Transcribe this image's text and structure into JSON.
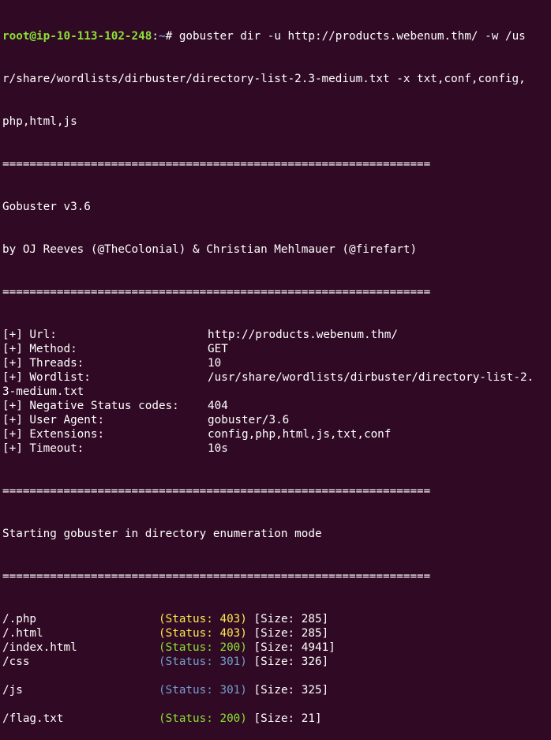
{
  "prompt": {
    "user_host": "root@ip-10-113-102-248",
    "colon": ":",
    "path": "~",
    "symbol": "# ",
    "command_line1": "gobuster dir -u http://products.webenum.thm/ -w /us",
    "command_line2": "r/share/wordlists/dirbuster/directory-list-2.3-medium.txt -x txt,conf,config,",
    "command_line3": "php,html,js"
  },
  "separator": "===============================================================",
  "banner": {
    "title": "Gobuster v3.6",
    "authors": "by OJ Reeves (@TheColonial) & Christian Mehlmauer (@firefart)"
  },
  "config": [
    {
      "key": "[+] Url:",
      "value": "http://products.webenum.thm/"
    },
    {
      "key": "[+] Method:",
      "value": "GET"
    },
    {
      "key": "[+] Threads:",
      "value": "10"
    },
    {
      "key": "[+] Wordlist:",
      "value": "/usr/share/wordlists/dirbuster/directory-list-2."
    },
    {
      "key": "3-medium.txt",
      "value": ""
    },
    {
      "key": "[+] Negative Status codes:",
      "value": "404"
    },
    {
      "key": "[+] User Agent:",
      "value": "gobuster/3.6"
    },
    {
      "key": "[+] Extensions:",
      "value": "config,php,html,js,txt,conf"
    },
    {
      "key": "[+] Timeout:",
      "value": "10s"
    }
  ],
  "start_message": "Starting gobuster in directory enumeration mode",
  "results": [
    {
      "path": "/.php",
      "status": "(Status: 403)",
      "code": "403",
      "size": "[Size: 285]"
    },
    {
      "path": "/.html",
      "status": "(Status: 403)",
      "code": "403",
      "size": "[Size: 285]"
    },
    {
      "path": "/index.html",
      "status": "(Status: 200)",
      "code": "200",
      "size": "[Size: 4941]"
    },
    {
      "path": "/css",
      "status": "(Status: 301)",
      "code": "301",
      "size": "[Size: 326]"
    },
    {
      "path": "",
      "status": "",
      "code": "",
      "size": ""
    },
    {
      "path": "/js",
      "status": "(Status: 301)",
      "code": "301",
      "size": "[Size: 325]"
    },
    {
      "path": "",
      "status": "",
      "code": "",
      "size": ""
    },
    {
      "path": "/flag.txt",
      "status": "(Status: 200)",
      "code": "200",
      "size": "[Size: 21]"
    }
  ],
  "colors": {
    "background": "#300a24",
    "prompt_user": "#8ae234",
    "prompt_path": "#729fcf",
    "status_403": "#fce94f",
    "status_200": "#8ae234",
    "status_301": "#729fcf"
  }
}
